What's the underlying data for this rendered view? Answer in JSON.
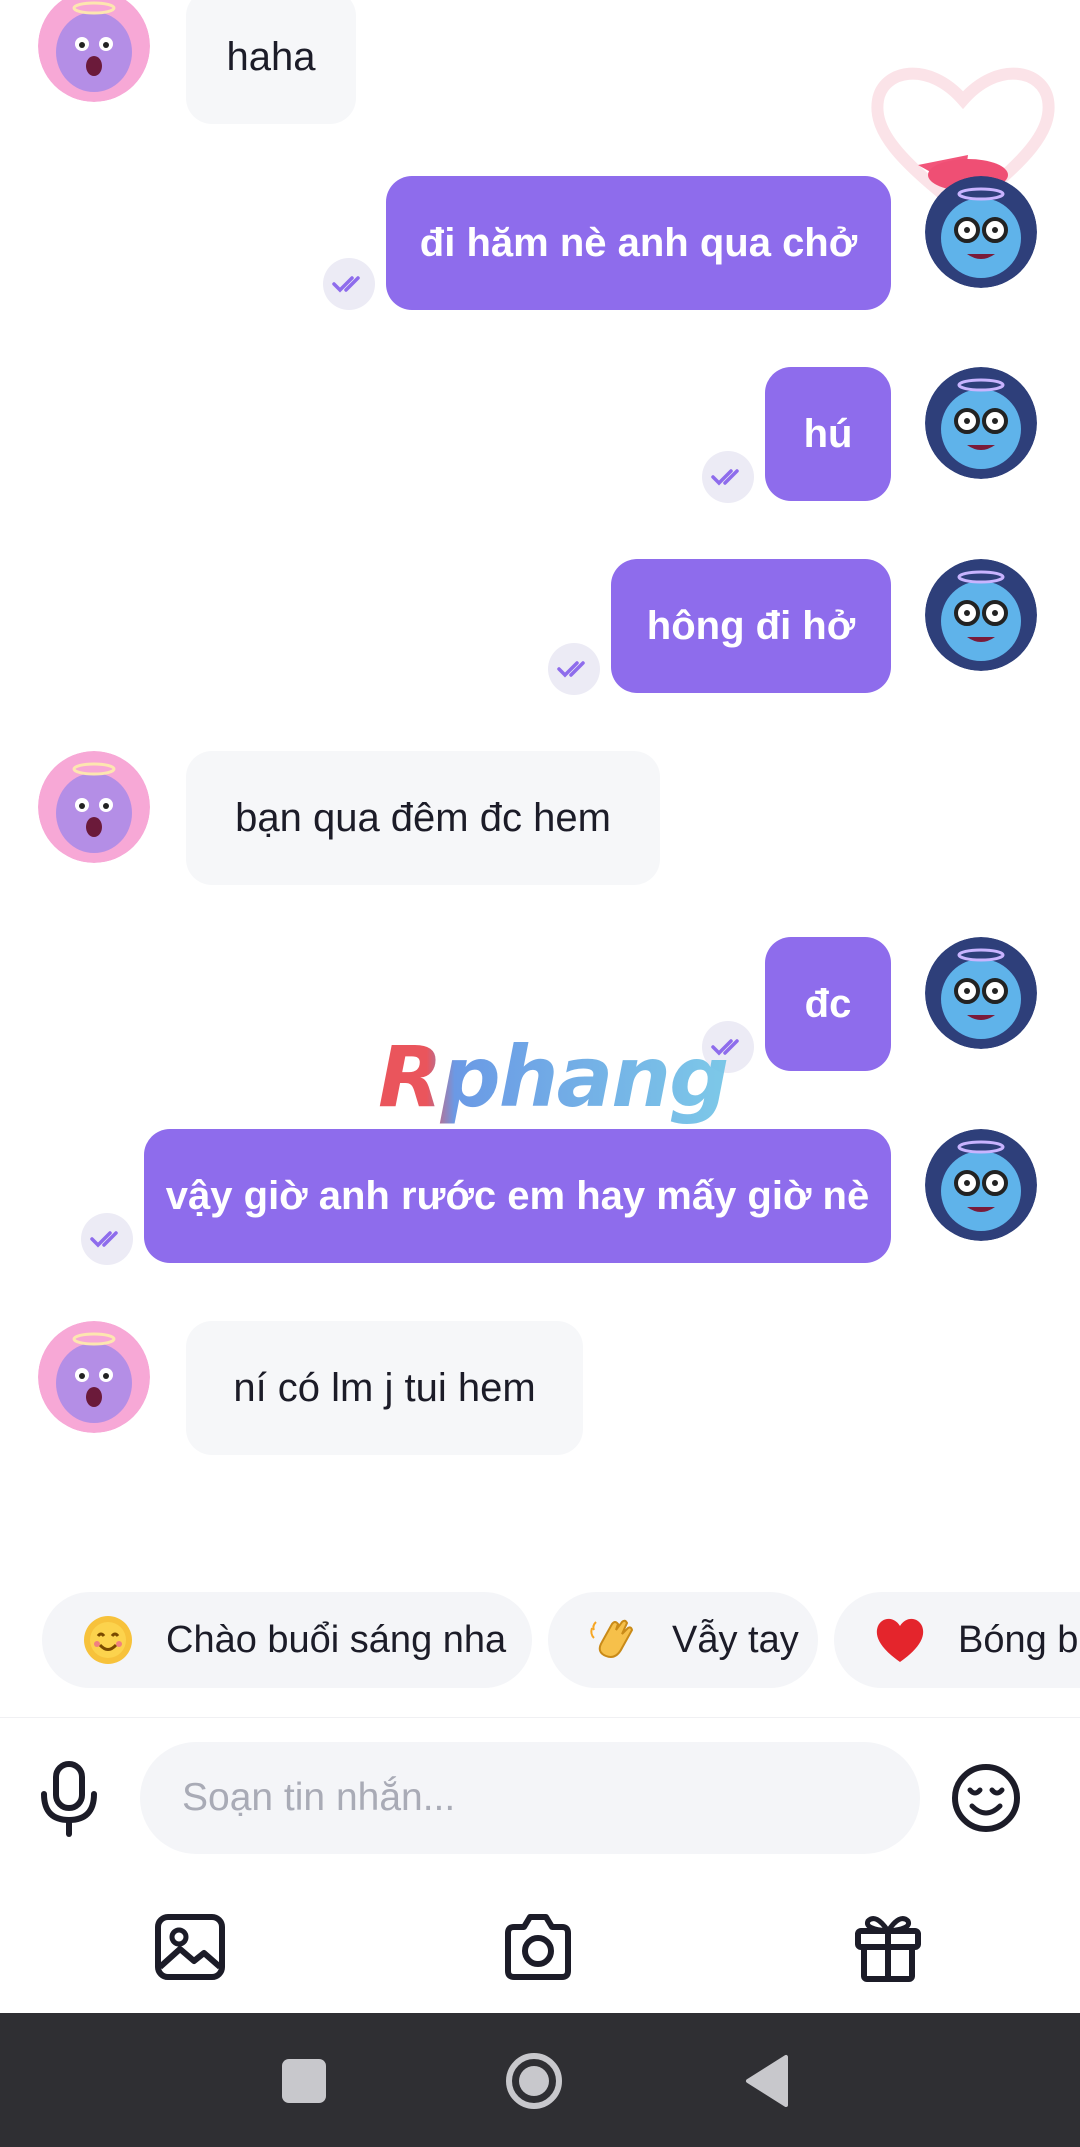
{
  "messages": [
    {
      "side": "in",
      "text": "haha"
    },
    {
      "side": "out",
      "text": "đi hăm nè anh qua chở"
    },
    {
      "side": "out",
      "text": "hú"
    },
    {
      "side": "out",
      "text": "hông đi hở"
    },
    {
      "side": "in",
      "text": "bạn qua đêm đc hem"
    },
    {
      "side": "out",
      "text": "đc"
    },
    {
      "side": "out",
      "text": "vậy giờ anh rước em hay mấy giờ nè"
    },
    {
      "side": "in",
      "text": "ní có lm j tui hem"
    }
  ],
  "watermark": "Rphang",
  "quick_replies": [
    {
      "emoji": "smiling-sun-emoji",
      "label": "Chào buổi sáng nha"
    },
    {
      "emoji": "waving-hand-emoji",
      "label": "Vẫy tay"
    },
    {
      "emoji": "red-heart-emoji",
      "label": "Bóng ba"
    }
  ],
  "composer": {
    "placeholder": "Soạn tin nhắn..."
  },
  "colors": {
    "outgoing_bubble": "#8e6cec",
    "incoming_bubble": "#f6f7f9",
    "read_tick": "#8e6cec",
    "nav_bar": "#2f2f33"
  },
  "icons": {
    "mic": "microphone-icon",
    "emoji": "smiley-icon",
    "image": "image-icon",
    "camera": "camera-icon",
    "gift": "gift-icon"
  }
}
